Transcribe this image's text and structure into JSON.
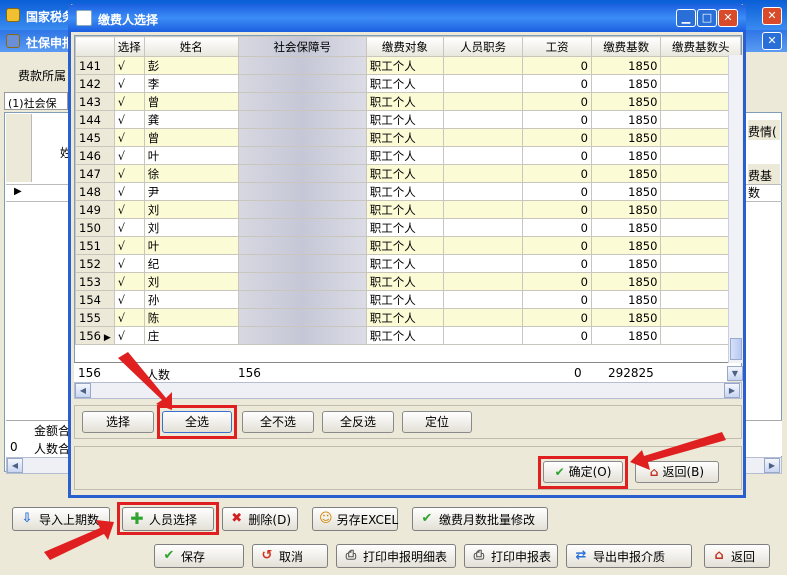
{
  "background": {
    "main_title": "国家税务",
    "sub_title": "社保申报",
    "dept_label": "费款所属",
    "tab_label": "(1)社会保",
    "col_partial": "姓",
    "right_col1": "费情(",
    "right_col2": "费基数",
    "sum_label1": "金额合",
    "sum_label2": "人数合",
    "sum_row0": "0"
  },
  "dialog": {
    "title": "缴费人选择",
    "columns": [
      "选择",
      "姓名",
      "社会保障号",
      "缴费对象",
      "人员职务",
      "工资",
      "缴费基数",
      "缴费基数头"
    ],
    "rows": [
      {
        "no": "141",
        "sel": "√",
        "name": "彭",
        "obj": "职工个人",
        "wage": "0",
        "base": "1850"
      },
      {
        "no": "142",
        "sel": "√",
        "name": "李",
        "obj": "职工个人",
        "wage": "0",
        "base": "1850"
      },
      {
        "no": "143",
        "sel": "√",
        "name": "曾",
        "obj": "职工个人",
        "wage": "0",
        "base": "1850"
      },
      {
        "no": "144",
        "sel": "√",
        "name": "龚",
        "obj": "职工个人",
        "wage": "0",
        "base": "1850"
      },
      {
        "no": "145",
        "sel": "√",
        "name": "曾",
        "obj": "职工个人",
        "wage": "0",
        "base": "1850"
      },
      {
        "no": "146",
        "sel": "√",
        "name": "叶",
        "obj": "职工个人",
        "wage": "0",
        "base": "1850"
      },
      {
        "no": "147",
        "sel": "√",
        "name": "徐",
        "obj": "职工个人",
        "wage": "0",
        "base": "1850"
      },
      {
        "no": "148",
        "sel": "√",
        "name": "尹",
        "obj": "职工个人",
        "wage": "0",
        "base": "1850"
      },
      {
        "no": "149",
        "sel": "√",
        "name": "刘",
        "obj": "职工个人",
        "wage": "0",
        "base": "1850"
      },
      {
        "no": "150",
        "sel": "√",
        "name": "刘",
        "obj": "职工个人",
        "wage": "0",
        "base": "1850"
      },
      {
        "no": "151",
        "sel": "√",
        "name": "叶",
        "obj": "职工个人",
        "wage": "0",
        "base": "1850"
      },
      {
        "no": "152",
        "sel": "√",
        "name": "纪",
        "obj": "职工个人",
        "wage": "0",
        "base": "1850"
      },
      {
        "no": "153",
        "sel": "√",
        "name": "刘",
        "obj": "职工个人",
        "wage": "0",
        "base": "1850"
      },
      {
        "no": "154",
        "sel": "√",
        "name": "孙",
        "obj": "职工个人",
        "wage": "0",
        "base": "1850"
      },
      {
        "no": "155",
        "sel": "√",
        "name": "陈",
        "obj": "职工个人",
        "wage": "0",
        "base": "1850"
      },
      {
        "no": "156",
        "sel": "√",
        "name": "庄",
        "obj": "职工个人",
        "wage": "0",
        "base": "1850"
      }
    ],
    "summary": {
      "no": "156",
      "label": "人数",
      "count": "156",
      "wage": "0",
      "base": "292825"
    },
    "btn_select": "选择",
    "btn_select_all": "全选",
    "btn_select_none": "全不选",
    "btn_invert": "全反选",
    "btn_locate": "定位",
    "btn_ok": "确定(O)",
    "btn_back": "返回(B)"
  },
  "toolbar1": {
    "import_prev": "导入上期数",
    "person_select": "人员选择",
    "delete": "删除(D)",
    "save_excel": "另存EXCEL",
    "batch_edit": "缴费月数批量修改"
  },
  "toolbar2": {
    "save": "保存",
    "cancel": "取消",
    "print_detail": "打印申报明细表",
    "print_report": "打印申报表",
    "export": "导出申报介质",
    "back": "返回"
  },
  "colors": {
    "highlight": "#e02020",
    "title_blue": "#1b5fe0",
    "row_yellow": "#fbfbd6"
  }
}
